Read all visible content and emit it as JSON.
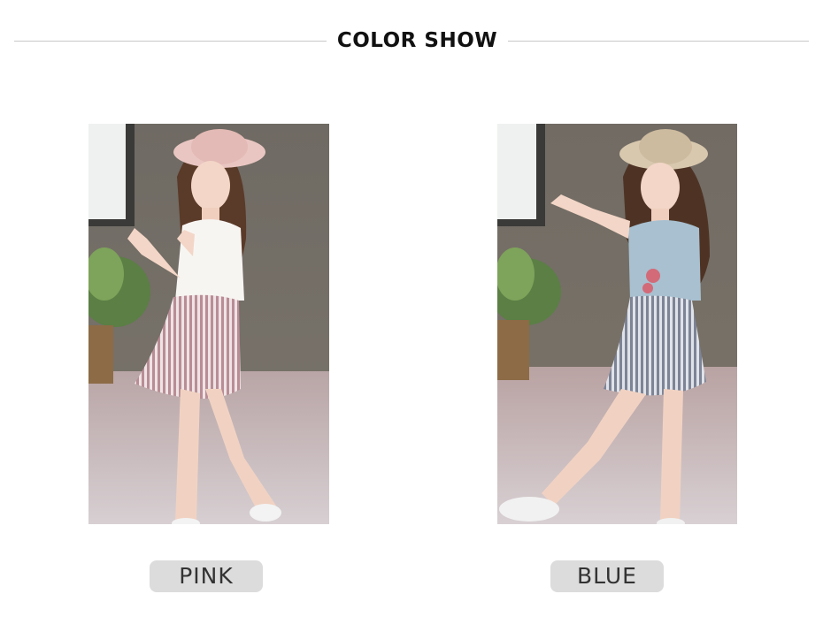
{
  "header": {
    "title": "COLOR SHOW"
  },
  "variants": [
    {
      "label": "PINK",
      "swatch": "#c9a3a8"
    },
    {
      "label": "BLUE",
      "swatch": "#9fb6c8"
    }
  ]
}
